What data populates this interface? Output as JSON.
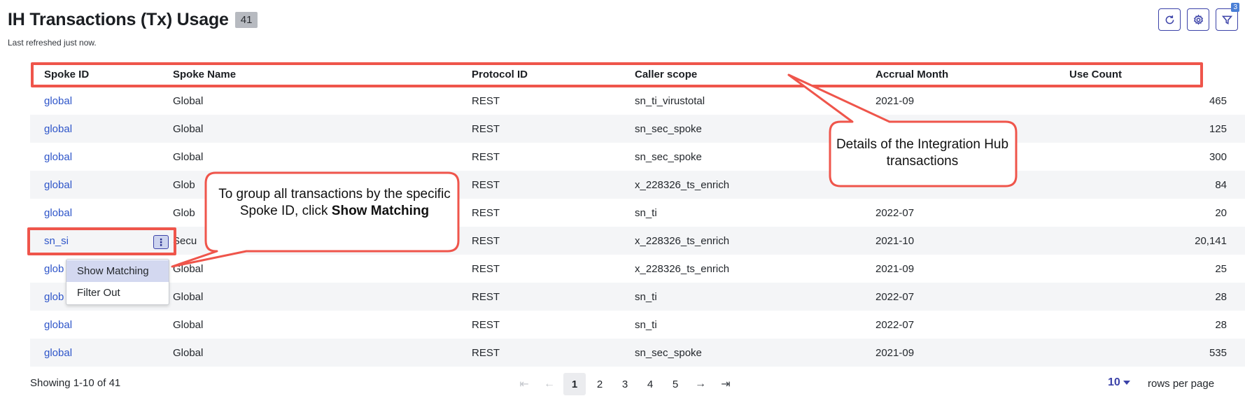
{
  "header": {
    "title": "IH Transactions (Tx) Usage",
    "count": "41",
    "refresh_text": "Last refreshed just now.",
    "filter_count": "3",
    "icons": [
      "refresh-icon",
      "gear-icon",
      "filter-icon"
    ]
  },
  "table": {
    "columns": [
      "Spoke ID",
      "Spoke Name",
      "Protocol ID",
      "Caller scope",
      "Accrual Month",
      "Use Count"
    ],
    "rows": [
      [
        "global",
        "Global",
        "REST",
        "sn_ti_virustotal",
        "2021-09",
        "465"
      ],
      [
        "global",
        "Global",
        "REST",
        "sn_sec_spoke",
        "",
        "125"
      ],
      [
        "global",
        "Global",
        "REST",
        "sn_sec_spoke",
        "",
        "300"
      ],
      [
        "global",
        "Glob",
        "REST",
        "x_228326_ts_enrich",
        "",
        "84"
      ],
      [
        "global",
        "Glob",
        "REST",
        "sn_ti",
        "2022-07",
        "20"
      ],
      [
        "sn_si",
        "Secu",
        "REST",
        "x_228326_ts_enrich",
        "2021-10",
        "20,141"
      ],
      [
        "glob",
        "Global",
        "REST",
        "x_228326_ts_enrich",
        "2021-09",
        "25"
      ],
      [
        "glob",
        "Global",
        "REST",
        "sn_ti",
        "2022-07",
        "28"
      ],
      [
        "global",
        "Global",
        "REST",
        "sn_ti",
        "2022-07",
        "28"
      ],
      [
        "global",
        "Global",
        "REST",
        "sn_sec_spoke",
        "2021-09",
        "535"
      ]
    ]
  },
  "context_menu": {
    "items": [
      "Show Matching",
      "Filter Out"
    ],
    "kebab": "⋮"
  },
  "callouts": {
    "group_prefix": "To group all transactions by the specific Spoke ID, click ",
    "group_bold": "Show Matching",
    "details": "Details of the Integration Hub transactions"
  },
  "footer": {
    "showing": "Showing 1-10 of 41",
    "pages": [
      "1",
      "2",
      "3",
      "4",
      "5"
    ],
    "rows_per_page_value": "10",
    "rows_per_page_label": "rows per page"
  },
  "colors": {
    "accent": "#3b42a8",
    "link": "#2e55c9",
    "highlight": "#ef554b"
  }
}
